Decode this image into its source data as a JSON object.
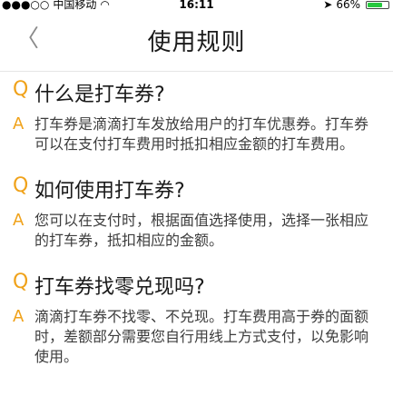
{
  "status": {
    "carrier": "中国移动",
    "time": "16:11",
    "battery": "66%",
    "battery_level": 0.66
  },
  "nav": {
    "back_symbol": "〈",
    "title": "使用规则"
  },
  "faq": [
    {
      "q_mark": "Q",
      "question": "什么是打车券?",
      "a_mark": "A",
      "answer": "打车券是滴滴打车发放给用户的打车优惠券。打车券可以在支付打车费用时抵扣相应金额的打车费用。"
    },
    {
      "q_mark": "Q",
      "question": "如何使用打车券?",
      "a_mark": "A",
      "answer": "您可以在支付时，根据面值选择使用，选择一张相应的打车券，抵扣相应的金额。"
    },
    {
      "q_mark": "Q",
      "question": "打车券找零兑现吗?",
      "a_mark": "A",
      "answer": "滴滴打车券不找零、不兑现。打车费用高于券的面额时，差额部分需要您自行用线上方式支付，以免影响使用。"
    }
  ]
}
